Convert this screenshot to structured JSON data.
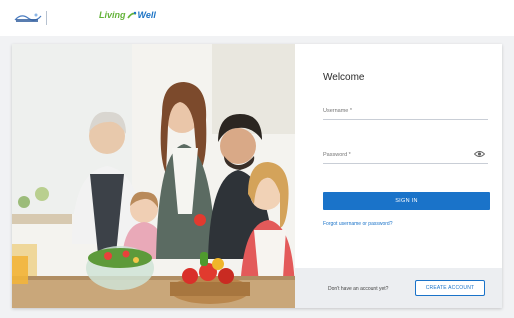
{
  "header": {
    "left_logo_alt": "health plan logo",
    "left_logo_text": "",
    "right_logo": {
      "part1": "Living",
      "part2": "Well"
    }
  },
  "login": {
    "title": "Welcome",
    "username_label": "Username *",
    "username_value": "",
    "password_label": "Password *",
    "password_value": "",
    "sign_in_label": "SIGN IN",
    "forgot_link": "Forgot username or password?",
    "no_account_text": "Don't have an account yet?",
    "create_account_label": "CREATE ACCOUNT"
  },
  "photo": {
    "description_icon": "family-cooking-photo"
  },
  "colors": {
    "accent": "#1a73c9",
    "living_green": "#64b33a",
    "footer_bg": "#eceef1"
  }
}
